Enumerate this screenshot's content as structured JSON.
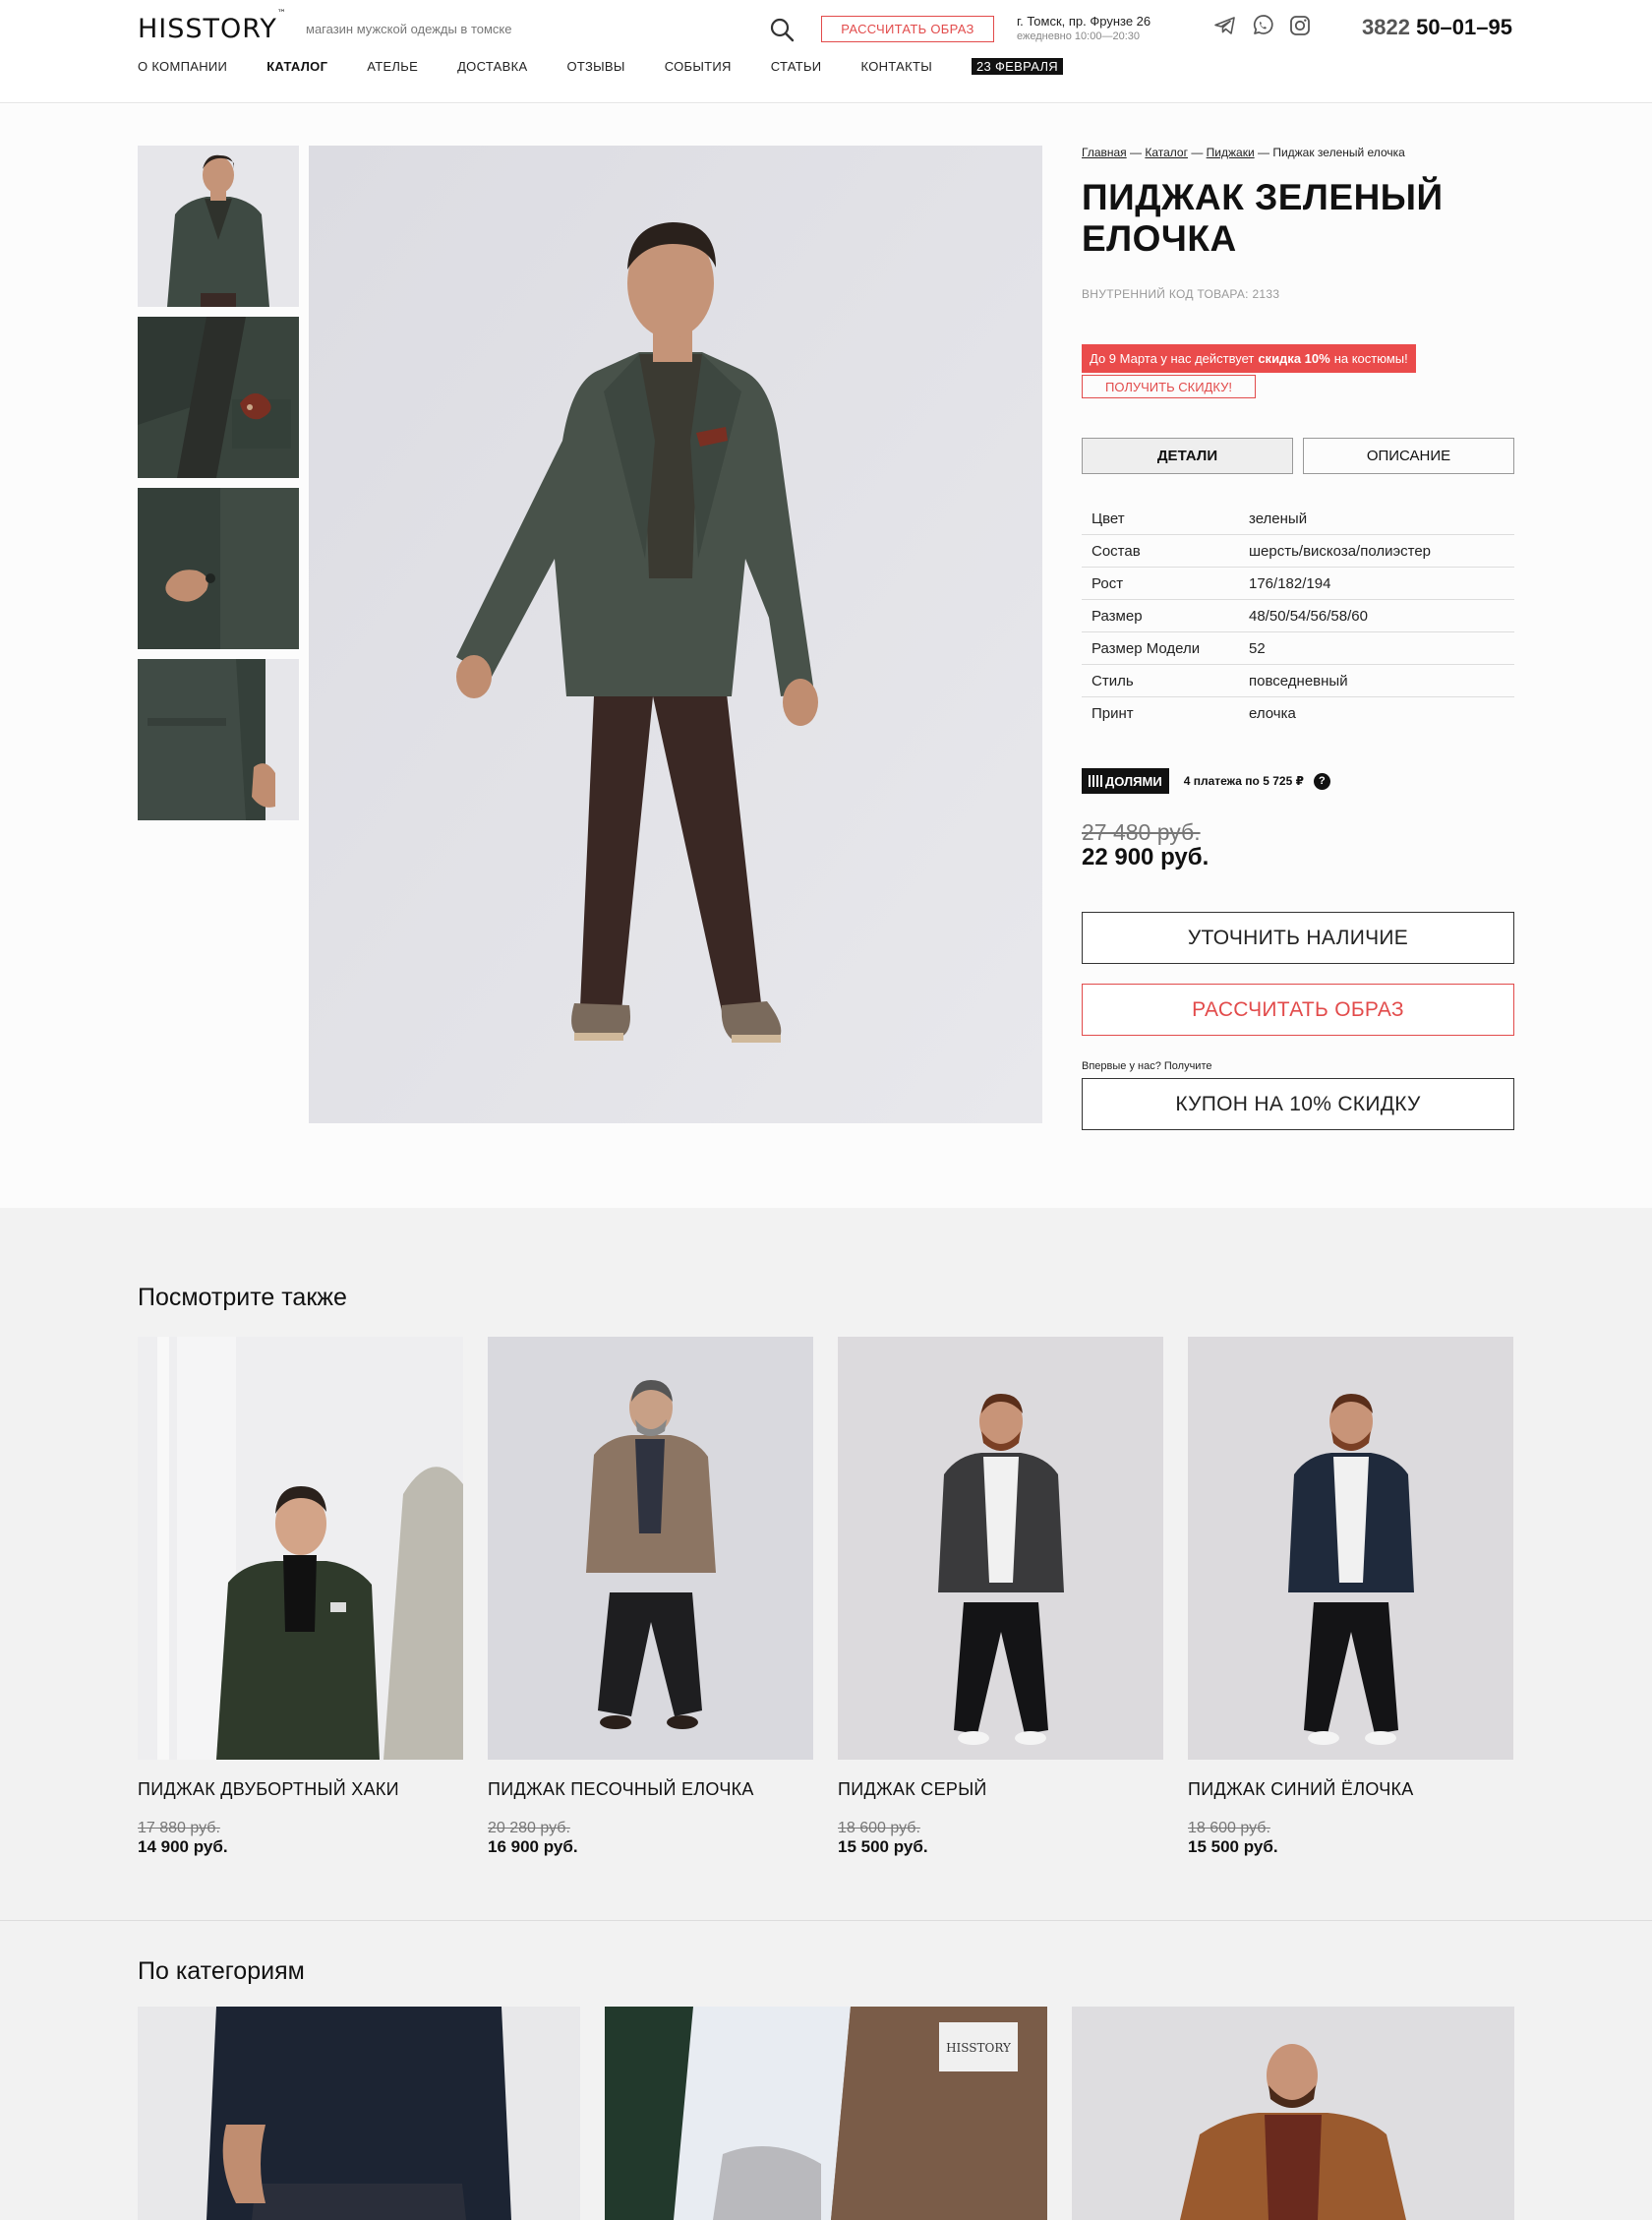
{
  "header": {
    "logo": "HISSTORY",
    "logo_mark": "™",
    "tagline": "магазин мужской одежды в томске",
    "calc_button": "РАССЧИТАТЬ ОБРАЗ",
    "address": "г. Томск, пр. Фрунзе 26",
    "hours": "ежедневно 10:00—20:30",
    "phone_code": "3822",
    "phone_number": "50–01–95",
    "socials": [
      "telegram-icon",
      "whatsapp-icon",
      "instagram-icon"
    ]
  },
  "nav": [
    {
      "label": "О КОМПАНИИ"
    },
    {
      "label": "КАТАЛОГ",
      "active": true
    },
    {
      "label": "АТЕЛЬЕ"
    },
    {
      "label": "ДОСТАВКА"
    },
    {
      "label": "ОТЗЫВЫ"
    },
    {
      "label": "СОБЫТИЯ"
    },
    {
      "label": "СТАТЬИ"
    },
    {
      "label": "КОНТАКТЫ"
    },
    {
      "label": "23 ФЕВРАЛЯ",
      "badge": true
    }
  ],
  "product": {
    "breadcrumb": [
      "Главная",
      "Каталог",
      "Пиджаки",
      "Пиджак зеленый елочка"
    ],
    "title": "ПИДЖАК ЗЕЛЕНЫЙ ЕЛОЧКА",
    "sku_label": "ВНУТРЕННИЙ КОД ТОВАРА:",
    "sku": "2133",
    "promo_pre": "До 9 Марта у нас действует",
    "promo_bold": "скидка 10%",
    "promo_post": "на костюмы!",
    "get_discount": "ПОЛУЧИТЬ СКИДКУ!",
    "tab_details": "ДЕТАЛИ",
    "tab_description": "ОПИСАНИЕ",
    "details": [
      {
        "key": "Цвет",
        "value": "зеленый"
      },
      {
        "key": "Состав",
        "value": "шерсть/вискоза/полиэстер"
      },
      {
        "key": "Рост",
        "value": "176/182/194"
      },
      {
        "key": "Размер",
        "value": "48/50/54/56/58/60"
      },
      {
        "key": "Размер Модели",
        "value": "52"
      },
      {
        "key": "Стиль",
        "value": "повседневный"
      },
      {
        "key": "Принт",
        "value": "елочка"
      }
    ],
    "dolyami_logo": "ДОЛЯМИ",
    "dolyami_text": "4 платежа по 5 725 ₽",
    "dolyami_help": "?",
    "old_price": "27 480 руб.",
    "new_price": "22 900 руб.",
    "btn_availability": "УТОЧНИТЬ НАЛИЧИЕ",
    "btn_calc": "РАССЧИТАТЬ ОБРАЗ",
    "first_visit": "Впервые у нас? Получите",
    "btn_coupon": "КУПОН НА 10% СКИДКУ"
  },
  "see_also": {
    "title": "Посмотрите также",
    "items": [
      {
        "name": "ПИДЖАК ДВУБОРТНЫЙ ХАКИ",
        "old": "17 880 руб.",
        "price": "14 900 руб."
      },
      {
        "name": "ПИДЖАК ПЕСОЧНЫЙ ЕЛОЧКА",
        "old": "20 280 руб.",
        "price": "16 900 руб."
      },
      {
        "name": "ПИДЖАК СЕРЫЙ",
        "old": "18 600 руб.",
        "price": "15 500 руб."
      },
      {
        "name": "ПИДЖАК СИНИЙ ЁЛОЧКА",
        "old": "18 600 руб.",
        "price": "15 500 руб."
      }
    ]
  },
  "categories": {
    "title": "По категориям",
    "shirt_label": "HISSTORY"
  },
  "colors": {
    "accent": "#e24b4b",
    "promo_bg": "#ea4b4b",
    "dark": "#111111",
    "section_bg": "#f2f2f2"
  }
}
